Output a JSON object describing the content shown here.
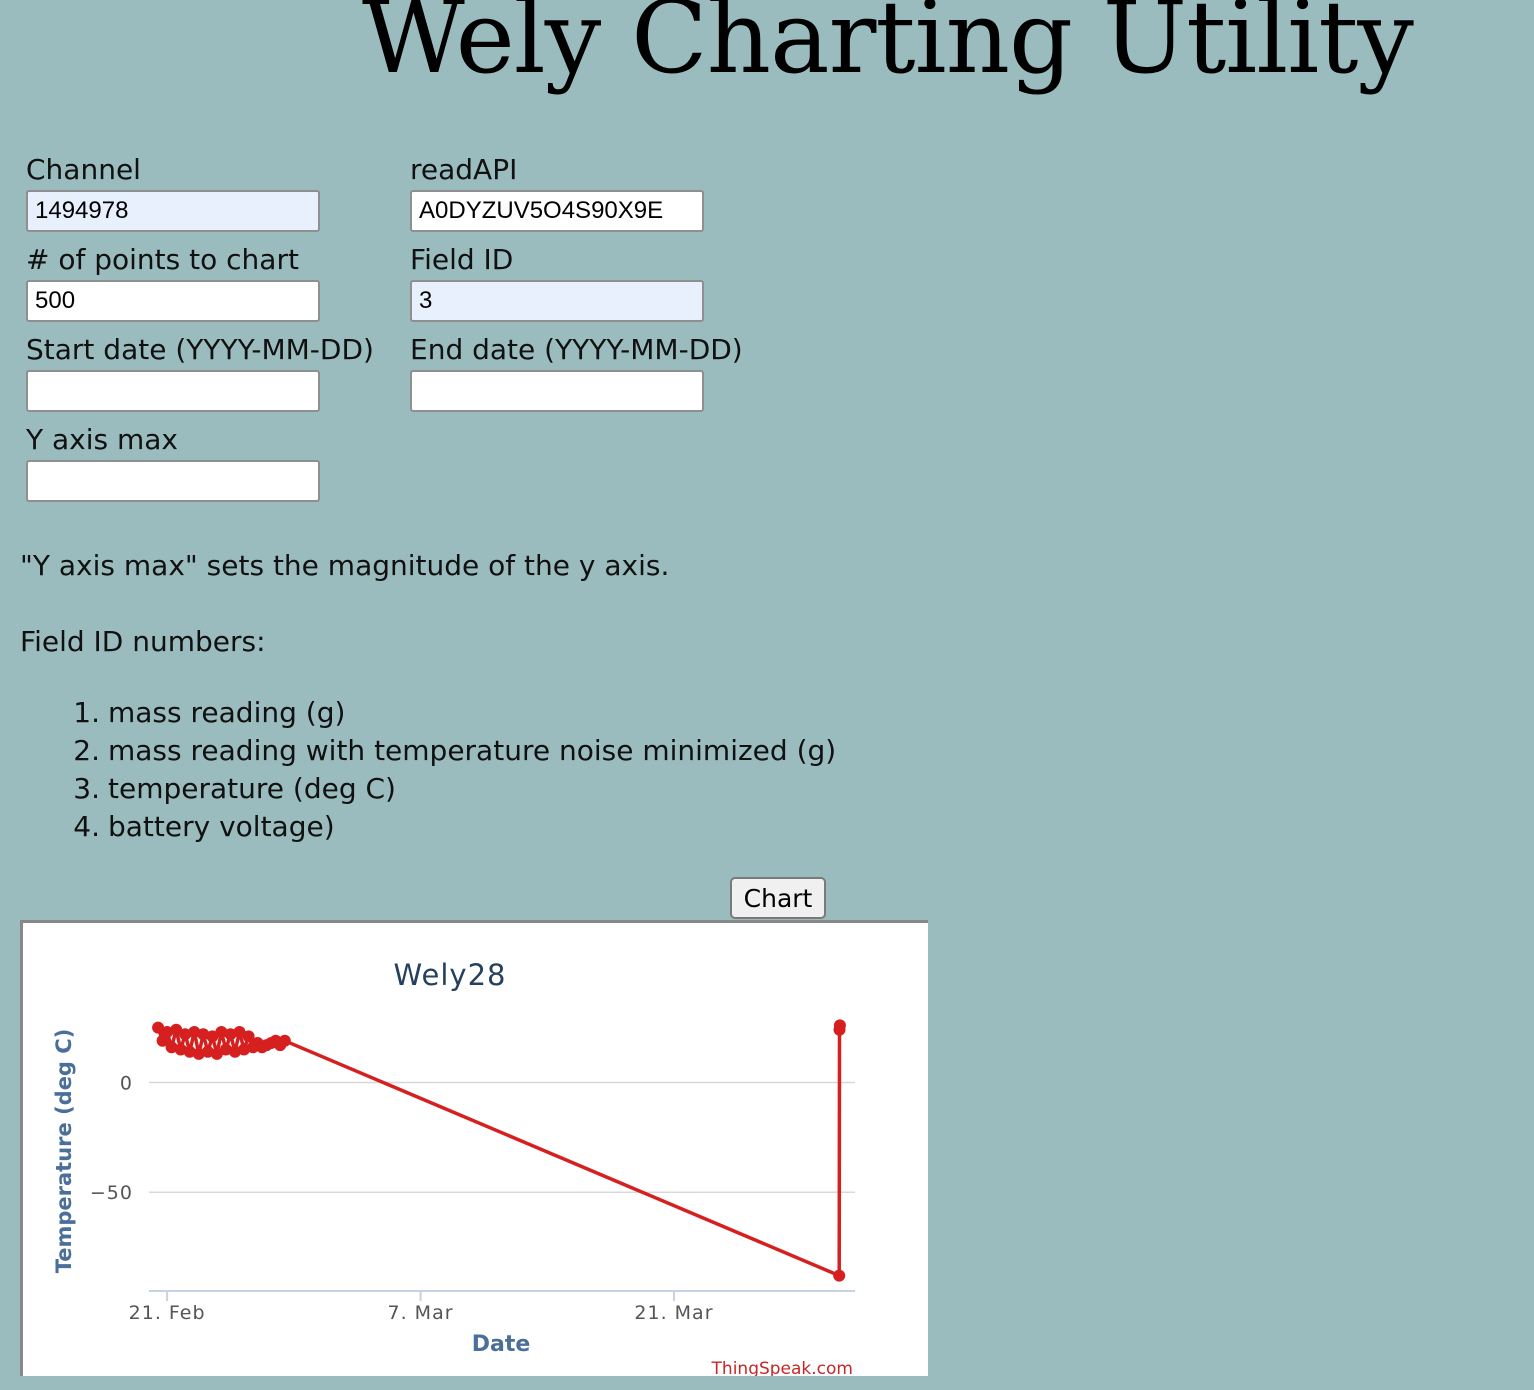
{
  "app": {
    "title": "Wely Charting Utility"
  },
  "form": {
    "channel": {
      "label": "Channel",
      "value": "1494978"
    },
    "read_api": {
      "label": "readAPI",
      "value": "A0DYZUV5O4S90X9E"
    },
    "points": {
      "label": "# of points to chart",
      "value": "500"
    },
    "field_id": {
      "label": "Field ID",
      "value": "3"
    },
    "start_date": {
      "label": "Start date (YYYY-MM-DD)",
      "value": ""
    },
    "end_date": {
      "label": "End date (YYYY-MM-DD)",
      "value": ""
    },
    "y_axis_max": {
      "label": "Y axis max",
      "value": ""
    }
  },
  "help": {
    "y_axis_note": "\"Y axis max\" sets the magnitude of the y axis.",
    "field_ids_heading": "Field ID numbers:",
    "field_ids": [
      {
        "num": "1.",
        "text": "mass reading (g)"
      },
      {
        "num": "2.",
        "text": "mass reading with temperature noise minimized (g)"
      },
      {
        "num": "3.",
        "text": "temperature (deg C)"
      },
      {
        "num": "4.",
        "text": "battery voltage)"
      }
    ]
  },
  "chart_button": {
    "label": "Chart"
  },
  "chart_credit": "ThingSpeak.com",
  "colors": {
    "page_background": "#9bbcbf",
    "series_line": "#d62020",
    "chart_title": "#26415e",
    "axis_title": "#4a6f98",
    "credit": "#c62828",
    "autofill_input": "#e8f0fe"
  },
  "chart_data": {
    "type": "line",
    "title": "Wely28",
    "xlabel": "Date",
    "ylabel": "Temperature (deg C)",
    "x_ticks": [
      "21. Feb",
      "7. Mar",
      "21. Mar"
    ],
    "y_ticks": [
      0,
      -50
    ],
    "xlim": [
      "2021-02-20",
      "2021-03-31"
    ],
    "ylim": [
      -95,
      28
    ],
    "grid": true,
    "legend": "none",
    "series": [
      {
        "color": "#d62020",
        "points": [
          [
            "2021-02-20T12:00",
            25
          ],
          [
            "2021-02-20T18:00",
            19
          ],
          [
            "2021-02-21T00:00",
            23
          ],
          [
            "2021-02-21T06:00",
            16
          ],
          [
            "2021-02-21T12:00",
            24
          ],
          [
            "2021-02-21T18:00",
            15
          ],
          [
            "2021-02-22T00:00",
            22
          ],
          [
            "2021-02-22T06:00",
            14
          ],
          [
            "2021-02-22T12:00",
            23
          ],
          [
            "2021-02-22T18:00",
            13
          ],
          [
            "2021-02-23T00:00",
            22
          ],
          [
            "2021-02-23T06:00",
            14
          ],
          [
            "2021-02-23T12:00",
            21
          ],
          [
            "2021-02-23T18:00",
            13
          ],
          [
            "2021-02-24T00:00",
            23
          ],
          [
            "2021-02-24T06:00",
            15
          ],
          [
            "2021-02-24T12:00",
            22
          ],
          [
            "2021-02-24T18:00",
            14
          ],
          [
            "2021-02-25T00:00",
            23
          ],
          [
            "2021-02-25T06:00",
            15
          ],
          [
            "2021-02-25T12:00",
            21
          ],
          [
            "2021-02-25T18:00",
            16
          ],
          [
            "2021-02-26T00:00",
            18
          ],
          [
            "2021-02-26T06:00",
            16
          ],
          [
            "2021-02-26T12:00",
            17
          ],
          [
            "2021-02-26T18:00",
            18
          ],
          [
            "2021-02-27T00:00",
            19
          ],
          [
            "2021-02-27T06:00",
            17
          ],
          [
            "2021-02-27T12:00",
            19
          ],
          [
            "2021-03-30T03:00",
            -88
          ],
          [
            "2021-03-30T03:30",
            24
          ],
          [
            "2021-03-30T04:00",
            26
          ]
        ]
      }
    ]
  }
}
